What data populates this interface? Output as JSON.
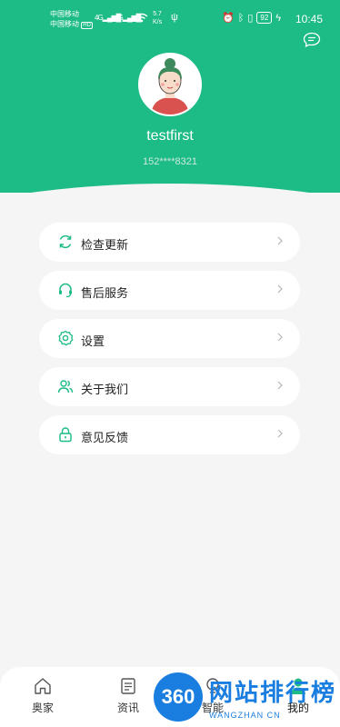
{
  "status_bar": {
    "carrier1": "中国移动",
    "carrier2": "中国移动",
    "hd_badge": "HD",
    "net1": "4G",
    "net2": "4G",
    "speed_value": "5.7",
    "speed_unit": "K/s",
    "battery": "92",
    "time": "10:45"
  },
  "profile": {
    "username": "testfirst",
    "phone": "152****8321"
  },
  "menu": {
    "items": [
      {
        "label": "检查更新",
        "icon": "refresh-icon"
      },
      {
        "label": "售后服务",
        "icon": "headset-icon"
      },
      {
        "label": "设置",
        "icon": "gear-icon"
      },
      {
        "label": "关于我们",
        "icon": "users-icon"
      },
      {
        "label": "意见反馈",
        "icon": "lock-icon"
      }
    ]
  },
  "tabbar": {
    "tabs": [
      {
        "label": "奥家",
        "icon": "home-icon"
      },
      {
        "label": "资讯",
        "icon": "news-icon"
      },
      {
        "label": "智能",
        "icon": "smart-icon"
      },
      {
        "label": "我的",
        "icon": "profile-icon"
      }
    ],
    "active_index": 3
  },
  "watermark": {
    "badge": "360",
    "text": "网站排行榜",
    "sub": "WANGZHAN CN"
  },
  "colors": {
    "brand": "#1dbb86",
    "background": "#f5f5f5",
    "watermark": "#1a7ee0"
  }
}
